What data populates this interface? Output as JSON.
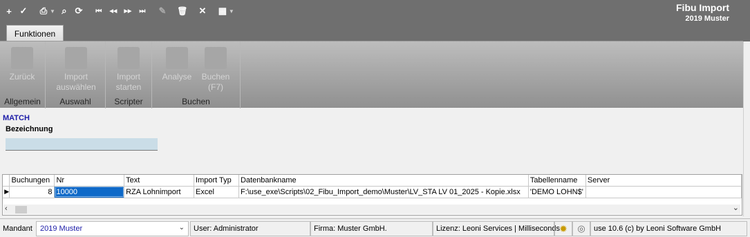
{
  "toolbar": {
    "icons": {
      "new": "+",
      "save": "✓",
      "print": "⎙",
      "search": "⌕",
      "refresh": "⟳",
      "first": "⏮",
      "prev": "◀◀",
      "next": "▶▶",
      "last": "⏭",
      "edit": "✎",
      "delete": "🗑",
      "cancel": "✕",
      "grid": "▦"
    }
  },
  "app": {
    "title": "Fibu Import",
    "subtitle": "2019 Muster"
  },
  "tabs": {
    "funktionen": "Funktionen"
  },
  "ribbon": {
    "groups": [
      {
        "label": "Allgemein",
        "buttons": [
          {
            "label": "Zurück"
          }
        ]
      },
      {
        "label": "Auswahl",
        "buttons": [
          {
            "label": "Import auswählen"
          }
        ]
      },
      {
        "label": "Scripter",
        "buttons": [
          {
            "label": "Import starten"
          }
        ]
      },
      {
        "label": "Buchen",
        "buttons": [
          {
            "label": "Analyse"
          },
          {
            "label": "Buchen (F7)"
          }
        ]
      }
    ]
  },
  "form": {
    "section_title": "MATCH",
    "bezeichnung_label": "Bezeichnung",
    "bezeichnung_value": ""
  },
  "grid": {
    "columns": [
      "Buchungen",
      "Nr",
      "Text",
      "Import Typ",
      "Datenbankname",
      "Tabellenname",
      "Server"
    ],
    "rows": [
      {
        "buchungen": "8",
        "nr": "10000",
        "text": "RZA Lohnimport",
        "import_typ": "Excel",
        "datenbankname": "F:\\use_exe\\Scripts\\02_Fibu_Import_demo\\Muster\\LV_STA LV 01_2025 - Kopie.xlsx",
        "tabellenname": "'DEMO LOHN$'",
        "server": ""
      }
    ],
    "row_indicator": "▶"
  },
  "status": {
    "mandant_label": "Mandant",
    "mandant_value": "2019 Muster",
    "user": "User: Administrator",
    "firma": "Firma: Muster GmbH.",
    "lizenz": "Lizenz: Leoni Services | Milliseconds",
    "version": "use 10.6 (c) by Leoni Software GmbH"
  }
}
